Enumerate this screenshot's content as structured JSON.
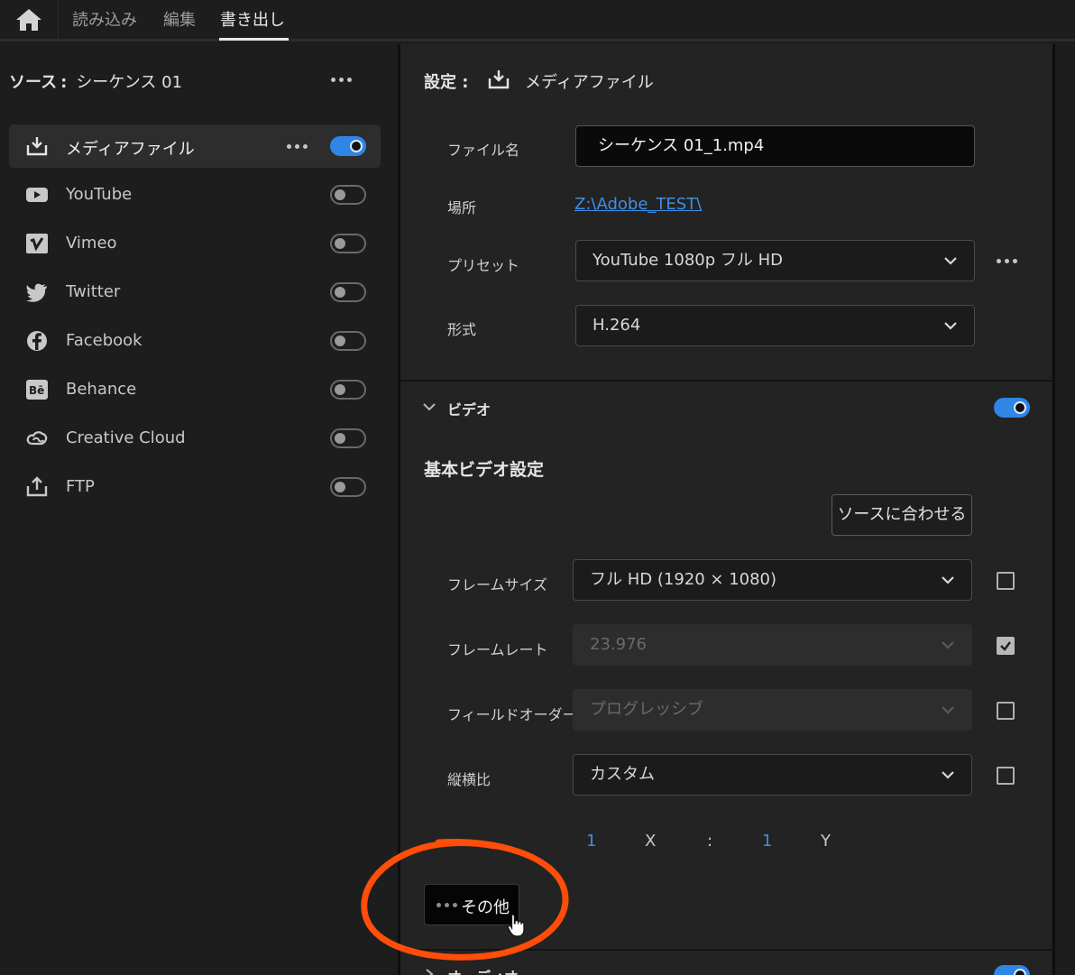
{
  "nav": {
    "tabs": [
      {
        "label": "読み込み",
        "active": false
      },
      {
        "label": "編集",
        "active": false
      },
      {
        "label": "書き出し",
        "active": true
      }
    ]
  },
  "source": {
    "label": "ソース",
    "colon": ":",
    "name": "シーケンス 01"
  },
  "destinations": [
    {
      "label": "メディアファイル",
      "icon": "download-icon",
      "enabled": true
    },
    {
      "label": "YouTube",
      "icon": "youtube-icon",
      "enabled": false
    },
    {
      "label": "Vimeo",
      "icon": "vimeo-icon",
      "enabled": false
    },
    {
      "label": "Twitter",
      "icon": "twitter-icon",
      "enabled": false
    },
    {
      "label": "Facebook",
      "icon": "facebook-icon",
      "enabled": false
    },
    {
      "label": "Behance",
      "icon": "behance-icon",
      "enabled": false
    },
    {
      "label": "Creative Cloud",
      "icon": "creative-cloud-icon",
      "enabled": false
    },
    {
      "label": "FTP",
      "icon": "upload-icon",
      "enabled": false
    }
  ],
  "settings": {
    "title": "設定",
    "colon": ":",
    "target": "メディアファイル",
    "filename": {
      "label": "ファイル名",
      "value": "シーケンス 01_1.mp4"
    },
    "location": {
      "label": "場所",
      "value": "Z:\\Adobe_TEST\\"
    },
    "preset": {
      "label": "プリセット",
      "value": "YouTube 1080p フル HD"
    },
    "format": {
      "label": "形式",
      "value": "H.264"
    }
  },
  "video": {
    "section_label": "ビデオ",
    "enabled": true,
    "basic_title": "基本ビデオ設定",
    "match_source_label": "ソースに合わせる",
    "frame_size": {
      "label": "フレームサイズ",
      "value": "フル HD (1920 × 1080)",
      "checked": false
    },
    "frame_rate": {
      "label": "フレームレート",
      "value": "23.976",
      "checked": true
    },
    "field_order": {
      "label": "フィールドオーダー",
      "value": "プログレッシブ",
      "checked": false
    },
    "aspect": {
      "label": "縦横比",
      "value": "カスタム",
      "checked": false
    },
    "ratio": {
      "x_value": "1",
      "x_label": "X",
      "sep": ":",
      "y_value": "1",
      "y_label": "Y"
    },
    "more_label": "その他"
  },
  "audio": {
    "section_label": "オーディオ",
    "enabled": true
  },
  "colors": {
    "accent": "#2f86e4",
    "link": "#3d8fe6",
    "annotation": "#ff4d0a"
  }
}
